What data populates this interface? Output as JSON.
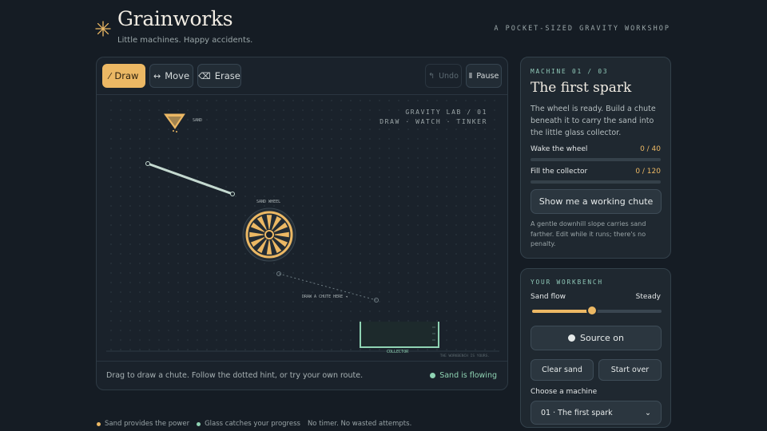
{
  "header": {
    "title": "Grainworks",
    "subtitle": "Little machines. Happy accidents.",
    "tagline": "A POCKET-SIZED GRAVITY WORKSHOP",
    "accent_color": "#ecb864"
  },
  "toolbar": {
    "draw_label": "Draw",
    "move_label": "Move",
    "erase_label": "Erase",
    "undo_label": "Undo",
    "pause_label": "Pause",
    "active_tool": "Draw"
  },
  "canvas": {
    "lab_title": "GRAVITY LAB / 01",
    "lab_subtitle": "DRAW · WATCH · TINKER",
    "sand_label": "SAND",
    "wheel_label": "SAND WHEEL",
    "chute_hint": "DRAW A CHUTE HERE",
    "collector_label": "COLLECTOR",
    "floor_note": "THE WORKBENCH IS YOURS."
  },
  "status": {
    "hint": "Drag to draw a chute. Follow the dotted hint, or try your own route.",
    "flow": "Sand is flowing",
    "flow_color": "#8fd3b3"
  },
  "machine": {
    "eyebrow": "MACHINE 01 / 03",
    "title": "The first spark",
    "body": "The wheel is ready. Build a chute beneath it to carry the sand into the little glass collector.",
    "goals": [
      {
        "label": "Wake the wheel",
        "value": "0 / 40",
        "progress": 0
      },
      {
        "label": "Fill the collector",
        "value": "0 / 120",
        "progress": 0
      }
    ],
    "hint_button": "Show me a working chute",
    "note": "A gentle downhill slope carries sand farther. Edit while it runs; there's no penalty."
  },
  "workbench": {
    "eyebrow": "YOUR WORKBENCH",
    "sand_flow_label": "Sand flow",
    "sand_flow_value": "Steady",
    "sand_flow_level": 0.46,
    "source_button": "Source on",
    "clear_button": "Clear sand",
    "restart_button": "Start over",
    "choose_label": "Choose a machine",
    "selected_machine": "01 · The first spark"
  },
  "footer": {
    "items": [
      {
        "text": "Sand provides the power",
        "color": "#ecb864"
      },
      {
        "text": "Glass catches your progress",
        "color": "#8fd3b3"
      },
      {
        "text": "No timer. No wasted attempts.",
        "color": ""
      }
    ]
  }
}
